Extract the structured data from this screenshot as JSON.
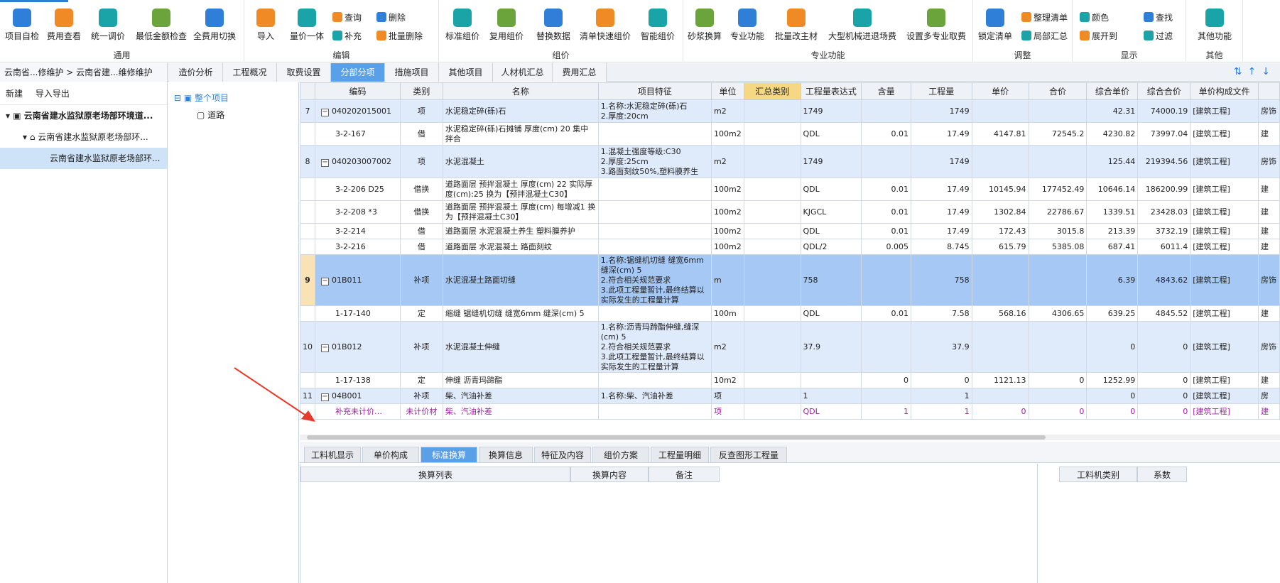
{
  "ribbon": {
    "groups": [
      {
        "label": "通用",
        "buttons": [
          "项目自检",
          "费用查看",
          "统一调价",
          "最低金额检查",
          "全费用切换"
        ]
      },
      {
        "label": "编辑",
        "buttons": [
          "导入",
          "量价一体"
        ],
        "small": [
          "查询",
          "补充",
          "删除",
          "批量删除"
        ]
      },
      {
        "label": "组价",
        "buttons": [
          "标准组价",
          "复用组价",
          "替换数据",
          "清单快速组价",
          "智能组价"
        ]
      },
      {
        "label": "专业功能",
        "buttons": [
          "砂浆换算",
          "专业功能",
          "批量改主材",
          "大型机械进退场费",
          "设置多专业取费"
        ]
      },
      {
        "label": "调整",
        "buttons": [
          "锁定清单"
        ],
        "small": [
          "整理清单",
          "局部汇总"
        ]
      },
      {
        "label": "显示",
        "small": [
          "颜色",
          "查找",
          "展开到",
          "过滤"
        ]
      },
      {
        "label": "其他",
        "buttons": [
          "其他功能"
        ]
      }
    ]
  },
  "breadcrumb": "云南省...修维护 > 云南省建...维修维护",
  "tabs": [
    "造价分析",
    "工程概况",
    "取费设置",
    "分部分项",
    "措施项目",
    "其他项目",
    "人材机汇总",
    "费用汇总"
  ],
  "left": {
    "toolbar": [
      "新建",
      "导入导出"
    ],
    "tree": [
      "云南省建水监狱原老场部环境道...",
      "云南省建水监狱原老场部环...",
      "云南省建水监狱原老场部环..."
    ]
  },
  "mid": {
    "tree": [
      "整个项目",
      "道路"
    ]
  },
  "grid": {
    "columns": [
      "编码",
      "类别",
      "名称",
      "项目特征",
      "单位",
      "汇总类别",
      "工程量表达式",
      "含量",
      "工程量",
      "单价",
      "合价",
      "综合单价",
      "综合合价",
      "单价构成文件"
    ],
    "rows": [
      {
        "no": "7",
        "code": "040202015001",
        "type": "项",
        "name": "水泥稳定碎(砾)石",
        "feat": "1.名称:水泥稳定碎(砾)石\n2.厚度:20cm",
        "unit": "m2",
        "sum": "",
        "expr": "1749",
        "content": "",
        "qty": "1749",
        "price": "",
        "total": "",
        "cprice": "42.31",
        "ctotal": "74000.19",
        "file": "[建筑工程]",
        "kind": "qd",
        "tail": "房饰"
      },
      {
        "no": "",
        "code": "3-2-167",
        "type": "借",
        "name": "水泥稳定碎(砾)石摊铺 厚度(cm) 20 集中拌合",
        "feat": "",
        "unit": "100m2",
        "sum": "",
        "expr": "QDL",
        "content": "0.01",
        "qty": "17.49",
        "price": "4147.81",
        "total": "72545.2",
        "cprice": "4230.82",
        "ctotal": "73997.04",
        "file": "[建筑工程]",
        "kind": "de",
        "tail": "建"
      },
      {
        "no": "8",
        "code": "040203007002",
        "type": "项",
        "name": "水泥混凝土",
        "feat": "1.混凝土强度等级:C30\n2.厚度:25cm\n3.路面刻纹50%,塑料膜养生",
        "unit": "m2",
        "sum": "",
        "expr": "1749",
        "content": "",
        "qty": "1749",
        "price": "",
        "total": "",
        "cprice": "125.44",
        "ctotal": "219394.56",
        "file": "[建筑工程]",
        "kind": "qd",
        "tail": "房饰"
      },
      {
        "no": "",
        "code": "3-2-206 D25",
        "type": "借换",
        "name": "道路面层 预拌混凝土 厚度(cm) 22 实际厚度(cm):25 换为【预拌混凝土C30】",
        "feat": "",
        "unit": "100m2",
        "sum": "",
        "expr": "QDL",
        "content": "0.01",
        "qty": "17.49",
        "price": "10145.94",
        "total": "177452.49",
        "cprice": "10646.14",
        "ctotal": "186200.99",
        "file": "[建筑工程]",
        "kind": "de",
        "tail": "建"
      },
      {
        "no": "",
        "code": "3-2-208 *3",
        "type": "借换",
        "name": "道路面层 预拌混凝土 厚度(cm) 每增减1 换为【预拌混凝土C30】",
        "feat": "",
        "unit": "100m2",
        "sum": "",
        "expr": "KJGCL",
        "content": "0.01",
        "qty": "17.49",
        "price": "1302.84",
        "total": "22786.67",
        "cprice": "1339.51",
        "ctotal": "23428.03",
        "file": "[建筑工程]",
        "kind": "de",
        "tail": "建"
      },
      {
        "no": "",
        "code": "3-2-214",
        "type": "借",
        "name": "道路面层 水泥混凝土养生 塑料膜养护",
        "feat": "",
        "unit": "100m2",
        "sum": "",
        "expr": "QDL",
        "content": "0.01",
        "qty": "17.49",
        "price": "172.43",
        "total": "3015.8",
        "cprice": "213.39",
        "ctotal": "3732.19",
        "file": "[建筑工程]",
        "kind": "de",
        "tail": "建"
      },
      {
        "no": "",
        "code": "3-2-216",
        "type": "借",
        "name": "道路面层 水泥混凝土 路面刻纹",
        "feat": "",
        "unit": "100m2",
        "sum": "",
        "expr": "QDL/2",
        "content": "0.005",
        "qty": "8.745",
        "price": "615.79",
        "total": "5385.08",
        "cprice": "687.41",
        "ctotal": "6011.4",
        "file": "[建筑工程]",
        "kind": "de",
        "tail": "建"
      },
      {
        "no": "9",
        "code": "01B011",
        "type": "补项",
        "name": "水泥混凝土路面切缝",
        "feat": "1.名称:锯缝机切缝 缝宽6mm 缝深(cm) 5\n2.符合相关规范要求\n3.此项工程量暂计,最终结算以实际发生的工程量计算",
        "unit": "m",
        "sum": "",
        "expr": "758",
        "content": "",
        "qty": "758",
        "price": "",
        "total": "",
        "cprice": "6.39",
        "ctotal": "4843.62",
        "file": "[建筑工程]",
        "kind": "sel",
        "tail": "房饰"
      },
      {
        "no": "",
        "code": "1-17-140",
        "type": "定",
        "name": "缩缝 锯缝机切缝 缝宽6mm 缝深(cm) 5",
        "feat": "",
        "unit": "100m",
        "sum": "",
        "expr": "QDL",
        "content": "0.01",
        "qty": "7.58",
        "price": "568.16",
        "total": "4306.65",
        "cprice": "639.25",
        "ctotal": "4845.52",
        "file": "[建筑工程]",
        "kind": "de",
        "tail": "建"
      },
      {
        "no": "10",
        "code": "01B012",
        "type": "补项",
        "name": "水泥混凝土伸缝",
        "feat": "1.名称:沥青玛蹄酯伸缝,缝深(cm) 5\n2.符合相关规范要求\n3.此项工程量暂计,最终结算以实际发生的工程量计算",
        "unit": "m2",
        "sum": "",
        "expr": "37.9",
        "content": "",
        "qty": "37.9",
        "price": "",
        "total": "",
        "cprice": "0",
        "ctotal": "0",
        "file": "[建筑工程]",
        "kind": "qd",
        "tail": "房饰"
      },
      {
        "no": "",
        "code": "1-17-138",
        "type": "定",
        "name": "伸缝 沥青玛蹄酯",
        "feat": "",
        "unit": "10m2",
        "sum": "",
        "expr": "",
        "content": "0",
        "qty": "0",
        "price": "1121.13",
        "total": "0",
        "cprice": "1252.99",
        "ctotal": "0",
        "file": "[建筑工程]",
        "kind": "de",
        "tail": "建"
      },
      {
        "no": "11",
        "code": "04B001",
        "type": "补项",
        "name": "柴、汽油补差",
        "feat": "1.名称:柴、汽油补差",
        "unit": "项",
        "sum": "",
        "expr": "1",
        "content": "",
        "qty": "1",
        "price": "",
        "total": "",
        "cprice": "0",
        "ctotal": "0",
        "file": "[建筑工程]",
        "kind": "qd",
        "tail": "房"
      },
      {
        "no": "",
        "code": "补充未计价…",
        "type": "未计价材",
        "name": "柴、汽油补差",
        "feat": "",
        "unit": "项",
        "sum": "",
        "expr": "QDL",
        "content": "1",
        "qty": "1",
        "price": "0",
        "total": "0",
        "cprice": "0",
        "ctotal": "0",
        "file": "[建筑工程]",
        "kind": "pur",
        "tail": "建"
      }
    ]
  },
  "bottom": {
    "tabs": [
      "工料机显示",
      "单价构成",
      "标准换算",
      "换算信息",
      "特征及内容",
      "组价方案",
      "工程量明细",
      "反查图形工程量"
    ],
    "active": "标准换算",
    "headers": [
      "换算列表",
      "换算内容",
      "备注"
    ],
    "right_headers": [
      "工料机类别",
      "系数"
    ]
  },
  "colors": {
    "accent": "#2f7fd8",
    "selected_row": "#a6c8f4",
    "qd_row": "#dfeafb",
    "annotation_arrow": "#e83a2a"
  }
}
